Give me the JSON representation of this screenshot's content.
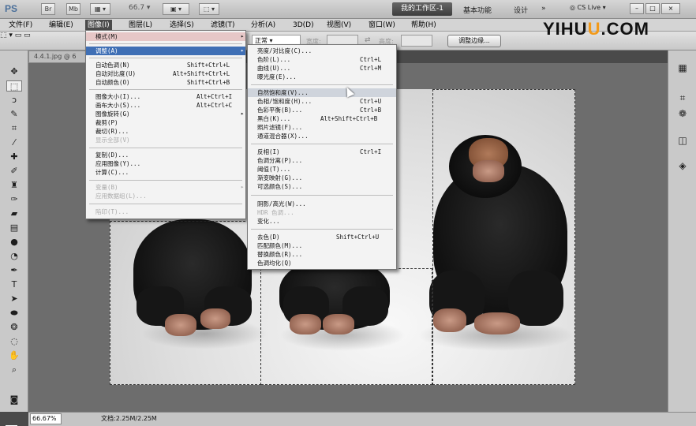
{
  "appbar": {
    "logo": "PS",
    "btn_br": "Br",
    "btn_mb": "Mb",
    "zoom": "66.7",
    "workspace_active": "我的工作区-1",
    "workspace_basic": "基本功能",
    "workspace_design": "设计",
    "more": "»",
    "cslive": "CS Live",
    "win_min": "–",
    "win_max": "□",
    "win_close": "×"
  },
  "menubar": {
    "items": [
      "文件(F)",
      "编辑(E)",
      "图像(I)",
      "图层(L)",
      "选择(S)",
      "滤镜(T)",
      "分析(A)",
      "3D(D)",
      "视图(V)",
      "窗口(W)",
      "帮助(H)"
    ]
  },
  "optbar": {
    "style_value": "正常",
    "width_label": "宽度:",
    "height_label": "高度:",
    "refine_edge": "调整边缘..."
  },
  "watermark": {
    "prefix": "YIHU",
    "accent": "U",
    "suffix": ".COM"
  },
  "document": {
    "tab_title": "4.4.1.jpg @ 6"
  },
  "statusbar": {
    "zoom": "66.67%",
    "docsize": "文档:2.25M/2.25M"
  },
  "image_menu": {
    "items": [
      {
        "label": "模式(M)",
        "shortcut": "",
        "submenu": true
      },
      {
        "label": "调整(A)",
        "shortcut": "",
        "submenu": true
      },
      {
        "label": "自动色调(N)",
        "shortcut": "Shift+Ctrl+L"
      },
      {
        "label": "自动对比度(U)",
        "shortcut": "Alt+Shift+Ctrl+L"
      },
      {
        "label": "自动颜色(O)",
        "shortcut": "Shift+Ctrl+B"
      },
      {
        "label": "图像大小(I)...",
        "shortcut": "Alt+Ctrl+I"
      },
      {
        "label": "画布大小(S)...",
        "shortcut": "Alt+Ctrl+C"
      },
      {
        "label": "图像旋转(G)",
        "shortcut": "",
        "submenu": true
      },
      {
        "label": "裁剪(P)",
        "shortcut": ""
      },
      {
        "label": "裁切(R)...",
        "shortcut": ""
      },
      {
        "label": "显示全部(V)",
        "shortcut": "",
        "disabled": true
      },
      {
        "label": "复制(D)...",
        "shortcut": ""
      },
      {
        "label": "应用图像(Y)...",
        "shortcut": ""
      },
      {
        "label": "计算(C)...",
        "shortcut": ""
      },
      {
        "label": "变量(B)",
        "shortcut": "",
        "submenu": true,
        "disabled": true
      },
      {
        "label": "应用数据组(L)...",
        "shortcut": "",
        "disabled": true
      },
      {
        "label": "陷印(T)...",
        "shortcut": "",
        "disabled": true
      }
    ]
  },
  "adjust_menu": {
    "items": [
      {
        "label": "亮度/对比度(C)...",
        "shortcut": ""
      },
      {
        "label": "色阶(L)...",
        "shortcut": "Ctrl+L"
      },
      {
        "label": "曲线(U)...",
        "shortcut": "Ctrl+M"
      },
      {
        "label": "曝光度(E)...",
        "shortcut": ""
      },
      {
        "label": "自然饱和度(V)...",
        "shortcut": ""
      },
      {
        "label": "色相/饱和度(H)...",
        "shortcut": "Ctrl+U"
      },
      {
        "label": "色彩平衡(B)...",
        "shortcut": "Ctrl+B"
      },
      {
        "label": "黑白(K)...",
        "shortcut": "Alt+Shift+Ctrl+B"
      },
      {
        "label": "照片滤镜(F)...",
        "shortcut": ""
      },
      {
        "label": "通道混合器(X)...",
        "shortcut": ""
      },
      {
        "label": "反相(I)",
        "shortcut": "Ctrl+I"
      },
      {
        "label": "色调分离(P)...",
        "shortcut": ""
      },
      {
        "label": "阈值(T)...",
        "shortcut": ""
      },
      {
        "label": "渐变映射(G)...",
        "shortcut": ""
      },
      {
        "label": "可选颜色(S)...",
        "shortcut": ""
      },
      {
        "label": "阴影/高光(W)...",
        "shortcut": ""
      },
      {
        "label": "HDR 色调...",
        "shortcut": "",
        "disabled": true
      },
      {
        "label": "变化...",
        "shortcut": ""
      },
      {
        "label": "去色(D)",
        "shortcut": "Shift+Ctrl+U"
      },
      {
        "label": "匹配颜色(M)...",
        "shortcut": ""
      },
      {
        "label": "替换颜色(R)...",
        "shortcut": ""
      },
      {
        "label": "色调均化(Q)",
        "shortcut": ""
      }
    ]
  },
  "colors": {
    "highlight": "#3f6fb5",
    "menu_active": "#4a4a4a",
    "logo_accent": "#f29a1a"
  }
}
